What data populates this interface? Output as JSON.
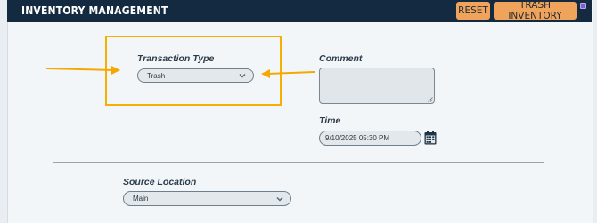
{
  "header": {
    "title": "INVENTORY MANAGEMENT",
    "reset_label": "RESET",
    "trash_label": "TRASH INVENTORY"
  },
  "form": {
    "transaction_type": {
      "label": "Transaction Type",
      "value": "Trash"
    },
    "comment": {
      "label": "Comment",
      "value": ""
    },
    "time": {
      "label": "Time",
      "value": "9/10/2025 05:30 PM"
    },
    "source_location": {
      "label": "Source Location",
      "value": "Main"
    }
  },
  "icons": {
    "chevron": "chevron-down-icon",
    "calendar": "calendar-icon",
    "arrows": "arrow-icon"
  },
  "colors": {
    "header_bg": "#142a40",
    "button_bg": "#f0a35a",
    "highlight": "#f5b000"
  }
}
